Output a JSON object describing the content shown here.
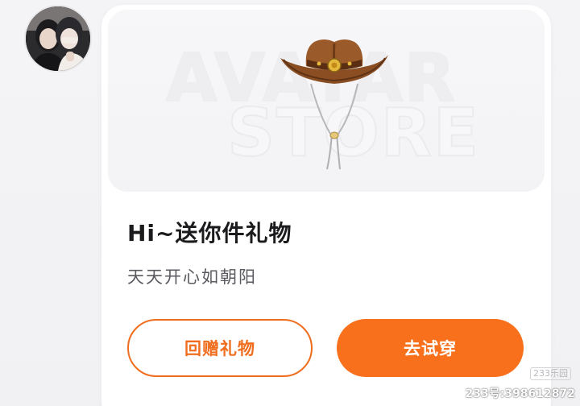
{
  "profile": {
    "avatar_icon": "user-avatar-photo"
  },
  "banner": {
    "watermark_line1": "AVATAR",
    "watermark_line2": "STORE",
    "item_icon": "cowboy-hat-icon"
  },
  "gift": {
    "title": "Hi~送你件礼物",
    "message": "天天开心如朝阳"
  },
  "actions": {
    "return_gift_label": "回赠礼物",
    "try_on_label": "去试穿"
  },
  "overlay": {
    "logo": "233乐园",
    "id_text": "233号:398612872"
  },
  "colors": {
    "accent": "#f8701c",
    "accent_outline": "#f06d1e",
    "title_text": "#1b1b1d",
    "subtitle_text": "#5a5a60",
    "card_bg": "#ffffff"
  }
}
